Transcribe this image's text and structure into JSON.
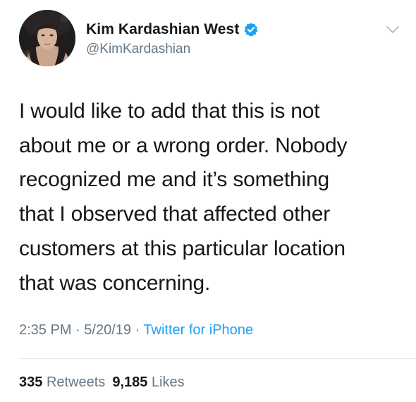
{
  "author": {
    "display_name": "Kim Kardashian West",
    "handle": "@KimKardashian",
    "verified": true,
    "avatar_icon": "user-avatar"
  },
  "tweet": {
    "lines": [
      "I would like to add that this is not",
      "about me or a wrong order. Nobody",
      "recognized me and it’s something",
      "that I observed that affected other",
      "customers at this particular location",
      "that was concerning."
    ]
  },
  "meta": {
    "time": "2:35 PM",
    "separator": "·",
    "date": "5/20/19",
    "source": "Twitter for iPhone"
  },
  "stats": {
    "retweets_count": "335",
    "retweets_label": "Retweets",
    "likes_count": "9,185",
    "likes_label": "Likes"
  },
  "colors": {
    "text": "#14171a",
    "secondary": "#657786",
    "accent": "#1da1f2",
    "divider": "#e1e8ed"
  },
  "icons": {
    "verified": "verified-badge-icon",
    "menu": "chevron-down-icon"
  }
}
